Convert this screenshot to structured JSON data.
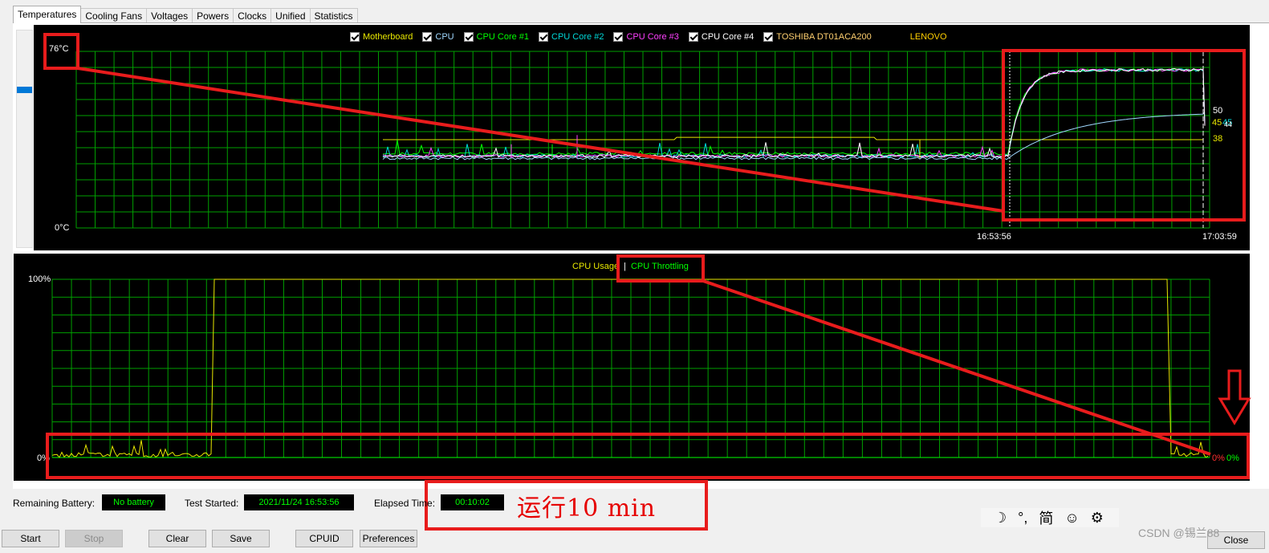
{
  "tabs": [
    {
      "label": "Temperatures",
      "active": true
    },
    {
      "label": "Cooling Fans",
      "active": false
    },
    {
      "label": "Voltages",
      "active": false
    },
    {
      "label": "Powers",
      "active": false
    },
    {
      "label": "Clocks",
      "active": false
    },
    {
      "label": "Unified",
      "active": false
    },
    {
      "label": "Statistics",
      "active": false
    }
  ],
  "temperature_chart": {
    "legend": [
      {
        "label": "Motherboard",
        "color": "#e8e800",
        "checked": true
      },
      {
        "label": "CPU",
        "color": "#a0d8ff",
        "checked": true
      },
      {
        "label": "CPU Core #1",
        "color": "#00ff00",
        "checked": true
      },
      {
        "label": "CPU Core #2",
        "color": "#00d8d8",
        "checked": true
      },
      {
        "label": "CPU Core #3",
        "color": "#ff40ff",
        "checked": true
      },
      {
        "label": "CPU Core #4",
        "color": "#ffffff",
        "checked": true
      },
      {
        "label": "TOSHIBA DT01ACA200",
        "color": "#ffd070",
        "checked": true
      },
      {
        "label": "LENOVO",
        "color": "#ffd000",
        "checked": false
      }
    ],
    "y_max_label": "76°C",
    "y_min_label": "0°C",
    "x_start_label": "16:53:56",
    "x_end_label": "17:03:59",
    "end_values": [
      {
        "text": "50",
        "color": "#ffffff"
      },
      {
        "text": "45",
        "color": "#e8e800"
      },
      {
        "text": "45",
        "color": "#00d8d8"
      },
      {
        "text": "44",
        "color": "#ffffff"
      },
      {
        "text": "38",
        "color": "#e8e800"
      }
    ]
  },
  "cpu_chart": {
    "legend": [
      {
        "label": "CPU Usage",
        "color": "#e8e800"
      },
      {
        "label": "CPU Throttling",
        "color": "#00ff00"
      }
    ],
    "separator": "|",
    "y_max_label": "100%",
    "y_min_label": "0%",
    "end_values": [
      {
        "text": "0%",
        "color": "#ff3030"
      },
      {
        "text": "0%",
        "color": "#00ff00"
      }
    ]
  },
  "status": {
    "battery_label": "Remaining Battery:",
    "battery_value": "No battery",
    "test_started_label": "Test Started:",
    "test_started_value": "2021/11/24 16:53:56",
    "elapsed_label": "Elapsed Time:",
    "elapsed_value": "00:10:02"
  },
  "buttons": {
    "start": "Start",
    "stop": "Stop",
    "clear": "Clear",
    "save": "Save",
    "cpuid": "CPUID",
    "preferences": "Preferences",
    "close": "Close"
  },
  "annotation_text": "运行10 min",
  "ime_toolbar": {
    "moon": "☽",
    "punct": "°,",
    "mode": "简",
    "emoji": "☺",
    "settings": "⚙"
  },
  "watermark": "CSDN @锡兰88",
  "chart_data": [
    {
      "type": "line",
      "title": "",
      "ylabel": "°C",
      "ylim": [
        0,
        76
      ],
      "x": [
        "16:53:56",
        "17:03:59"
      ],
      "series": [
        {
          "name": "Motherboard",
          "values": [
            38,
            38
          ]
        },
        {
          "name": "CPU",
          "values": [
            30,
            50
          ]
        },
        {
          "name": "CPU Core #1",
          "values": [
            32,
            45
          ]
        },
        {
          "name": "CPU Core #2",
          "values": [
            31,
            45
          ]
        },
        {
          "name": "CPU Core #3",
          "values": [
            31,
            44
          ]
        },
        {
          "name": "CPU Core #4",
          "values": [
            31,
            44
          ]
        }
      ]
    },
    {
      "type": "line",
      "title": "",
      "ylim": [
        0,
        100
      ],
      "series": [
        {
          "name": "CPU Usage",
          "values": [
            0,
            100,
            100,
            0
          ]
        },
        {
          "name": "CPU Throttling",
          "values": [
            0,
            0,
            0,
            0
          ]
        }
      ]
    }
  ]
}
